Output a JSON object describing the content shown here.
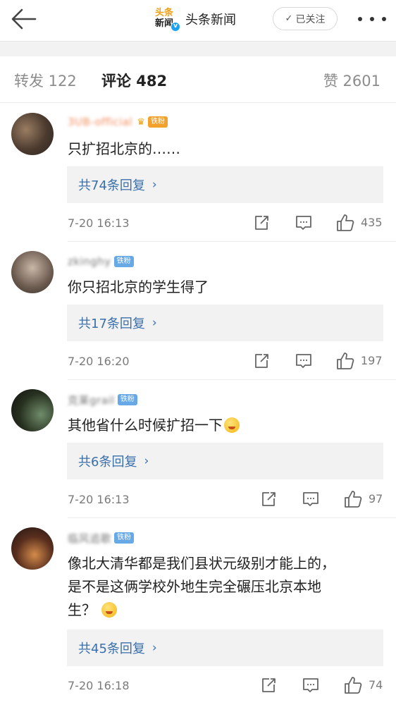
{
  "header": {
    "logo_line1": "头条",
    "logo_line2": "新闻",
    "account_name": "头条新闻",
    "follow_label": "已关注"
  },
  "tabs": {
    "repost": "转发 122",
    "comment": "评论 482",
    "like": "赞 2601"
  },
  "comments": [
    {
      "username": "3UB-official",
      "fan_badge": "铁粉",
      "text": "只扩招北京的……",
      "replies": "共74条回复",
      "time": "7-20 16:13",
      "likes": "435"
    },
    {
      "username": "zkinghy",
      "fan_badge": "铁粉",
      "text": "你只招北京的学生得了",
      "replies": "共17条回复",
      "time": "7-20 16:20",
      "likes": "197"
    },
    {
      "username": "克莱grail",
      "fan_badge": "铁粉",
      "text": "其他省什么时候扩招一下",
      "replies": "共6条回复",
      "time": "7-20 16:13",
      "likes": "97"
    },
    {
      "username": "临风追歌",
      "fan_badge": "铁粉",
      "text_line1": "像北大清华都是我们县状元级别才能上的，",
      "text_line2": "是不是这俩学校外地生完全碾压北京本地",
      "text_line3": "生？",
      "replies": "共45条回复",
      "time": "7-20 16:18",
      "likes": "74"
    }
  ],
  "colors": {
    "link_blue": "#3a6faa",
    "fan_gold": "#f2a12b",
    "fan_blue": "#66a9e6",
    "reply_bg": "#f2f2f2"
  }
}
